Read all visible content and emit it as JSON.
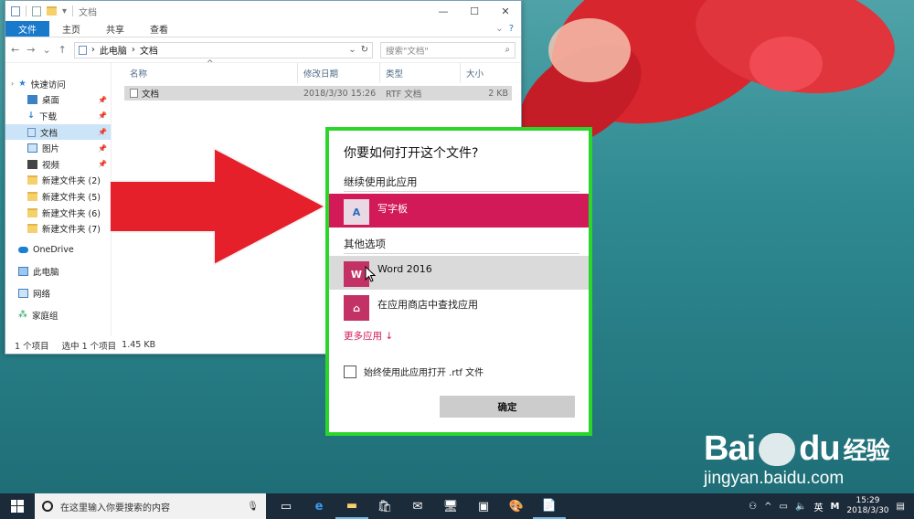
{
  "explorer": {
    "title": "文档",
    "ribbon_tabs": [
      "文件",
      "主页",
      "共享",
      "查看"
    ],
    "address": [
      "此电脑",
      "文档"
    ],
    "search_placeholder": "搜索\"文档\"",
    "nav_quick": "快速访问",
    "nav_items": [
      {
        "label": "桌面",
        "pinned": true
      },
      {
        "label": "下载",
        "pinned": true
      },
      {
        "label": "文档",
        "pinned": true,
        "selected": true
      },
      {
        "label": "图片",
        "pinned": true
      },
      {
        "label": "视频",
        "pinned": true
      },
      {
        "label": "新建文件夹 (2)"
      },
      {
        "label": "新建文件夹 (5)"
      },
      {
        "label": "新建文件夹 (6)"
      },
      {
        "label": "新建文件夹 (7)"
      }
    ],
    "nav_roots": [
      "OneDrive",
      "此电脑",
      "网络",
      "家庭组"
    ],
    "columns": [
      "名称",
      "修改日期",
      "类型",
      "大小"
    ],
    "files": [
      {
        "name": "文档",
        "date": "2018/3/30 15:26",
        "type": "RTF 文档",
        "size": "2 KB"
      }
    ],
    "status": [
      "1 个项目",
      "选中 1 个项目",
      "1.45 KB"
    ]
  },
  "dialog": {
    "title": "你要如何打开这个文件?",
    "section_keep": "继续使用此应用",
    "keep_app": "写字板",
    "section_other": "其他选项",
    "other_apps": [
      "Word 2016",
      "在应用商店中查找应用"
    ],
    "more_apps": "更多应用 ↓",
    "always_use": "始终使用此应用打开 .rtf 文件",
    "ok": "确定"
  },
  "watermark": {
    "brand": "Bai",
    "brand2": "du",
    "cn": "经验",
    "url": "jingyan.baidu.com"
  },
  "taskbar": {
    "search_placeholder": "在这里输入你要搜索的内容",
    "ime": "英",
    "time": "15:29",
    "date": "2018/3/30"
  },
  "colors": {
    "accent": "#d31a59",
    "dialog_border": "#2bd62b",
    "ribbon_file": "#1979ca"
  }
}
